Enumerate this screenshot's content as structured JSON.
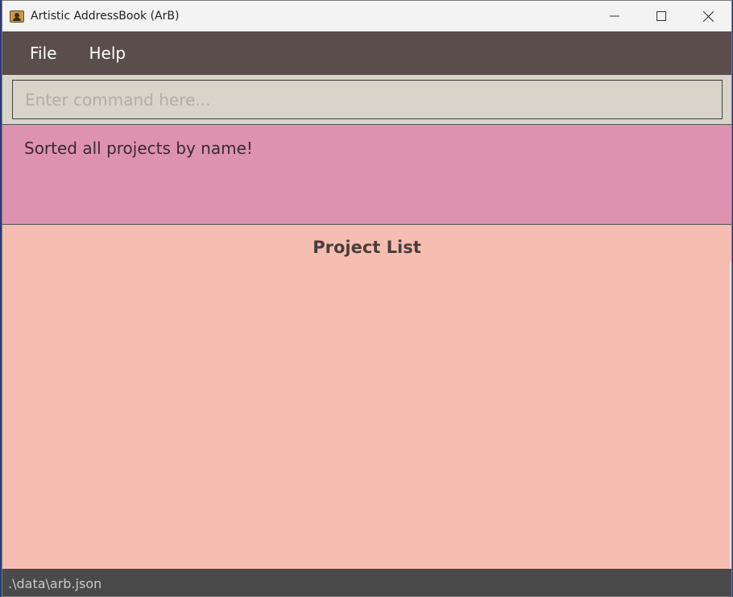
{
  "window": {
    "title": "Artistic AddressBook (ArB)",
    "icon": "address-book-icon"
  },
  "controls": {
    "minimize_icon": "minimize-icon",
    "maximize_icon": "maximize-icon",
    "close_icon": "close-icon"
  },
  "menu": {
    "items": [
      {
        "label": "File"
      },
      {
        "label": "Help"
      }
    ]
  },
  "command": {
    "value": "",
    "placeholder": "Enter command here..."
  },
  "result": {
    "message": "Sorted all projects by name!"
  },
  "project_list": {
    "title": "Project List",
    "items": []
  },
  "status": {
    "path": ".\\data\\arb.json"
  },
  "colors": {
    "menubar": "#5b4d4b",
    "command_bg": "#d8d4c9",
    "result_bg": "#dd93af",
    "project_bg": "#f6beb2",
    "statusbar": "#4a4a4a"
  }
}
